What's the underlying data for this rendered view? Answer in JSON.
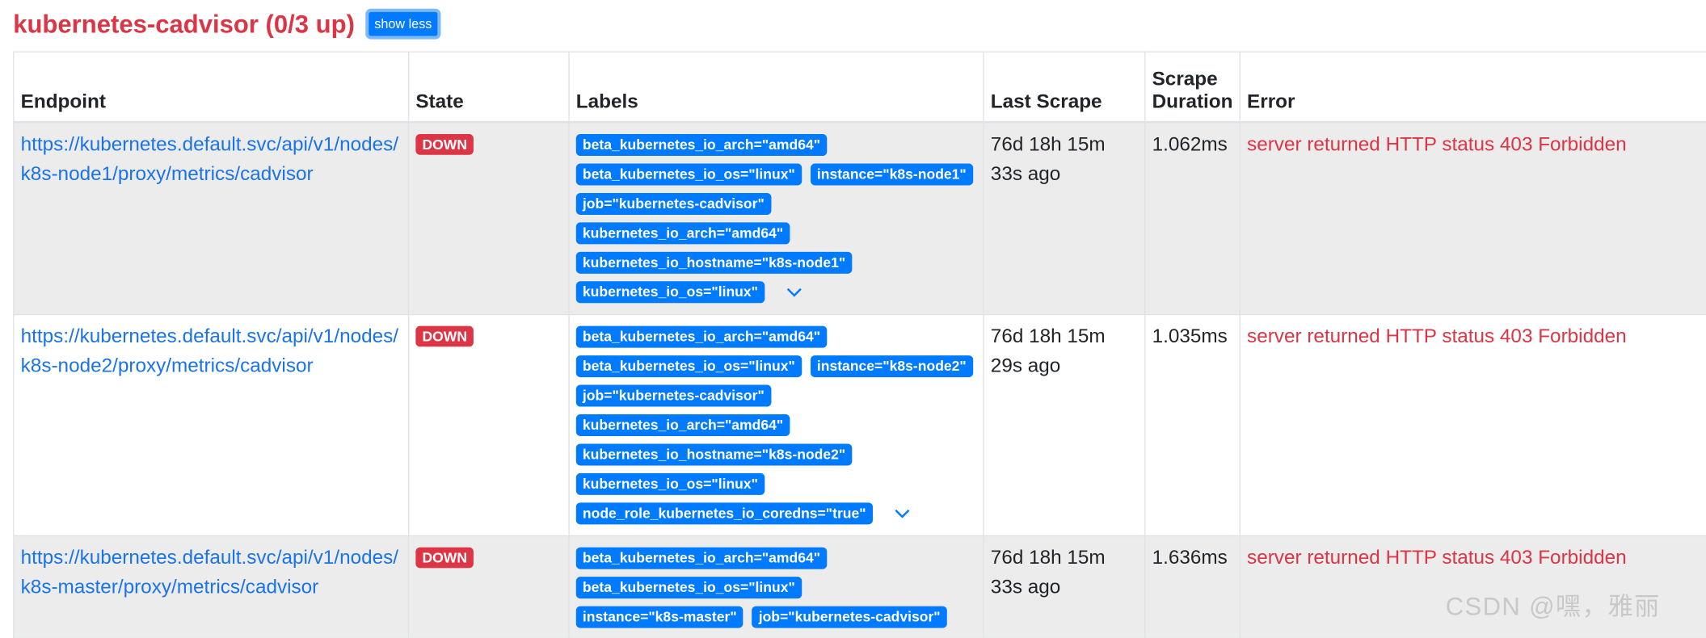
{
  "job": {
    "title": "kubernetes-cadvisor (0/3 up)",
    "toggle_label": "show less"
  },
  "columns": [
    "Endpoint",
    "State",
    "Labels",
    "Last Scrape",
    "Scrape Duration",
    "Error"
  ],
  "rows": [
    {
      "endpoint_line1": "https://kubernetes.default.svc/api/v1/nodes/",
      "endpoint_line2": "k8s-node1/proxy/metrics/cadvisor",
      "state": "DOWN",
      "labels": [
        "beta_kubernetes_io_arch=\"amd64\"",
        "beta_kubernetes_io_os=\"linux\"",
        "instance=\"k8s-node1\"",
        "job=\"kubernetes-cadvisor\"",
        "kubernetes_io_arch=\"amd64\"",
        "kubernetes_io_hostname=\"k8s-node1\"",
        "kubernetes_io_os=\"linux\""
      ],
      "last_scrape": "76d 18h 15m 33s ago",
      "duration": "1.062ms",
      "error": "server returned HTTP status 403 Forbidden"
    },
    {
      "endpoint_line1": "https://kubernetes.default.svc/api/v1/nodes/",
      "endpoint_line2": "k8s-node2/proxy/metrics/cadvisor",
      "state": "DOWN",
      "labels": [
        "beta_kubernetes_io_arch=\"amd64\"",
        "beta_kubernetes_io_os=\"linux\"",
        "instance=\"k8s-node2\"",
        "job=\"kubernetes-cadvisor\"",
        "kubernetes_io_arch=\"amd64\"",
        "kubernetes_io_hostname=\"k8s-node2\"",
        "kubernetes_io_os=\"linux\"",
        "node_role_kubernetes_io_coredns=\"true\""
      ],
      "last_scrape": "76d 18h 15m 29s ago",
      "duration": "1.035ms",
      "error": "server returned HTTP status 403 Forbidden"
    },
    {
      "endpoint_line1": "https://kubernetes.default.svc/api/v1/nodes/",
      "endpoint_line2": "k8s-master/proxy/metrics/cadvisor",
      "state": "DOWN",
      "labels": [
        "beta_kubernetes_io_arch=\"amd64\"",
        "beta_kubernetes_io_os=\"linux\"",
        "instance=\"k8s-master\"",
        "job=\"kubernetes-cadvisor\""
      ],
      "last_scrape": "76d 18h 15m 33s ago",
      "duration": "1.636ms",
      "error": "server returned HTTP status 403 Forbidden"
    }
  ],
  "watermark": "CSDN @嘿，雅丽",
  "colors": {
    "accent": "#007bff",
    "danger": "#dc3545",
    "link": "#1a73e8",
    "stripe": "#ececec"
  },
  "icons": {
    "expand": "chevron-down-icon"
  }
}
